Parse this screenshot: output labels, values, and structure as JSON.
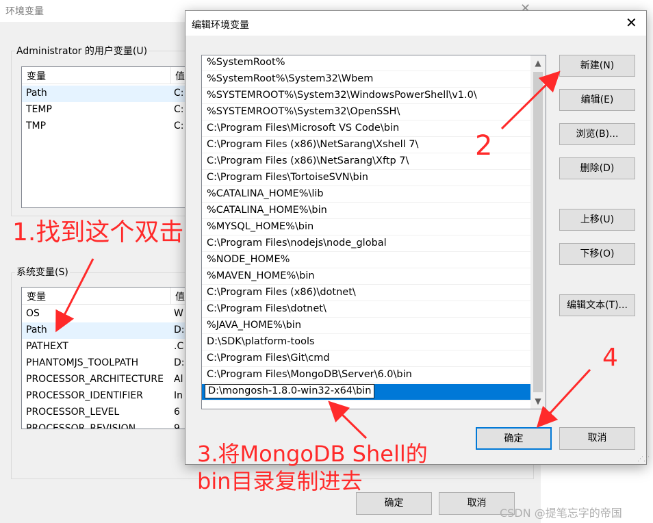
{
  "background_dialog": {
    "title": "环境变量",
    "user_vars": {
      "group_label": "Administrator 的用户变量(U)",
      "col_variable": "变量",
      "col_value": "值",
      "rows": [
        {
          "name": "Path",
          "value": "C:"
        },
        {
          "name": "TEMP",
          "value": "C:"
        },
        {
          "name": "TMP",
          "value": "C:"
        }
      ]
    },
    "system_vars": {
      "group_label": "系统变量(S)",
      "col_variable": "变量",
      "col_value": "值",
      "rows": [
        {
          "name": "OS",
          "value": "W"
        },
        {
          "name": "Path",
          "value": "D:"
        },
        {
          "name": "PATHEXT",
          "value": ".C"
        },
        {
          "name": "PHANTOMJS_TOOLPATH",
          "value": "D:"
        },
        {
          "name": "PROCESSOR_ARCHITECTURE",
          "value": "Al"
        },
        {
          "name": "PROCESSOR_IDENTIFIER",
          "value": "In"
        },
        {
          "name": "PROCESSOR_LEVEL",
          "value": "6"
        },
        {
          "name": "PROCESSOR_REVISION",
          "value": "9"
        }
      ]
    },
    "ok_label": "确定",
    "cancel_label": "取消"
  },
  "edit_dialog": {
    "title": "编辑环境变量",
    "paths": [
      "%SystemRoot%",
      "%SystemRoot%\\System32\\Wbem",
      "%SYSTEMROOT%\\System32\\WindowsPowerShell\\v1.0\\",
      "%SYSTEMROOT%\\System32\\OpenSSH\\",
      "C:\\Program Files\\Microsoft VS Code\\bin",
      "C:\\Program Files (x86)\\NetSarang\\Xshell 7\\",
      "C:\\Program Files (x86)\\NetSarang\\Xftp 7\\",
      "C:\\Program Files\\TortoiseSVN\\bin",
      "%CATALINA_HOME%\\lib",
      "%CATALINA_HOME%\\bin",
      "%MYSQL_HOME%\\bin",
      "C:\\Program Files\\nodejs\\node_global",
      "%NODE_HOME%",
      "%MAVEN_HOME%\\bin",
      "C:\\Program Files (x86)\\dotnet\\",
      "C:\\Program Files\\dotnet\\",
      "%JAVA_HOME%\\bin",
      "D:\\SDK\\platform-tools",
      "C:\\Program Files\\Git\\cmd",
      "C:\\Program Files\\MongoDB\\Server\\6.0\\bin"
    ],
    "editing_value": "D:\\mongosh-1.8.0-win32-x64\\bin",
    "buttons": {
      "new": "新建(N)",
      "edit": "编辑(E)",
      "browse": "浏览(B)...",
      "delete": "删除(D)",
      "move_up": "上移(U)",
      "move_down": "下移(O)",
      "edit_text": "编辑文本(T)...",
      "ok": "确定",
      "cancel": "取消"
    }
  },
  "annotations": {
    "step1": "1.找到这个双击",
    "step2": "2",
    "step3_line1": "3.将MongoDB Shell的",
    "step3_line2": "bin目录复制进去",
    "step4": "4",
    "color": "#ff2a2a"
  },
  "watermark": "CSDN @提笔忘字的帝国"
}
